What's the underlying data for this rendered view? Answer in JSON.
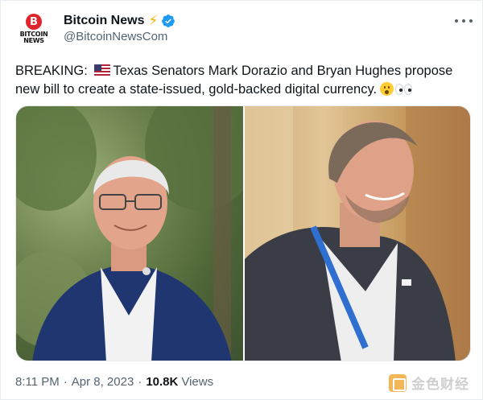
{
  "tweet": {
    "author": {
      "display_name": "Bitcoin News",
      "handle": "@BitcoinNewsCom",
      "avatar_text": "BITCOIN\nNEWS",
      "avatar_coin": "B",
      "verified": true
    },
    "text": {
      "lead": "BREAKING: ",
      "body": "Texas Senators Mark Dorazio and Bryan Hughes propose new bill to create a state-issued, gold-backed digital currency."
    },
    "emoji": [
      "us-flag",
      "astonished-face",
      "eyes"
    ],
    "media_count": 2,
    "meta": {
      "time": "8:11 PM",
      "separator": "·",
      "date": "Apr 8, 2023",
      "views_count": "10.8K",
      "views_label": "Views"
    }
  },
  "watermark": {
    "text": "金色财经"
  },
  "colors": {
    "text_primary": "#0f1419",
    "text_secondary": "#536471",
    "verified_blue": "#1d9bf0",
    "avatar_red": "#e0242e",
    "bolt_yellow": "#f5b400"
  }
}
